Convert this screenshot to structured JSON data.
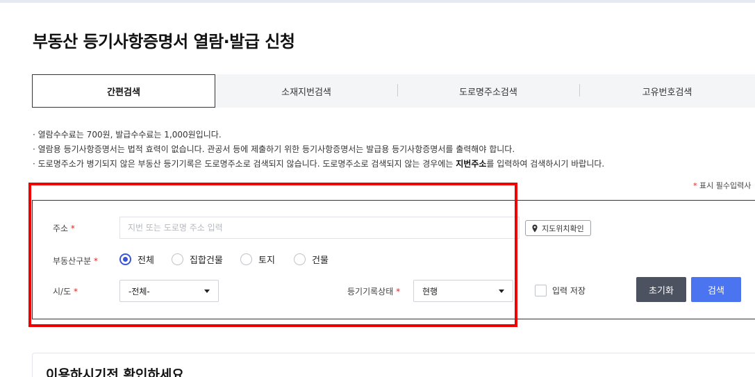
{
  "page": {
    "title": "부동산 등기사항증명서 열람·발급 신청"
  },
  "tabs": [
    {
      "label": "간편검색",
      "active": true
    },
    {
      "label": "소재지번검색",
      "active": false
    },
    {
      "label": "도로명주소검색",
      "active": false
    },
    {
      "label": "고유번호검색",
      "active": false
    }
  ],
  "notes": {
    "line1": "· 열람수수료는 700원, 발급수수료는 1,000원입니다.",
    "line2": "· 열람용 등기사항증명서는 법적 효력이 없습니다. 관공서 등에 제출하기 위한 등기사항증명서는 발급용 등기사항증명서를 출력해야 합니다.",
    "line3_pre": "· 도로명주소가 병기되지 않은 부동산 등기기록은 도로명주소로 검색되지 않습니다. 도로명주소로 검색되지 않는 경우에는 ",
    "line3_bold": "지번주소",
    "line3_post": "를 입력하여 검색하시기 바랍니다."
  },
  "required_note": {
    "star": "*",
    "text": " 표시 필수입력사"
  },
  "form": {
    "required_mark": "*",
    "address": {
      "label": "주소",
      "placeholder": "지번 또는 도로명 주소 입력",
      "value": ""
    },
    "map_button": {
      "label": "지도위치확인",
      "icon": "map-pin-icon"
    },
    "property_type": {
      "label": "부동산구분",
      "options": [
        {
          "label": "전체",
          "selected": true
        },
        {
          "label": "집합건물",
          "selected": false
        },
        {
          "label": "토지",
          "selected": false
        },
        {
          "label": "건물",
          "selected": false
        }
      ]
    },
    "sido": {
      "label": "시/도",
      "selected": "-전체-"
    },
    "record_status": {
      "label": "등기기록상태",
      "selected": "현행"
    },
    "save_input": {
      "label": "입력 저장",
      "checked": false
    },
    "reset_button": "초기화",
    "search_button": "검색"
  },
  "bottom": {
    "title": "이용하시기전 확인하세요"
  },
  "colors": {
    "primary": "#4a74f0",
    "reset": "#4d5261",
    "radio_accent": "#3a55d8",
    "highlight": "#ee0000",
    "required": "#e02424"
  }
}
